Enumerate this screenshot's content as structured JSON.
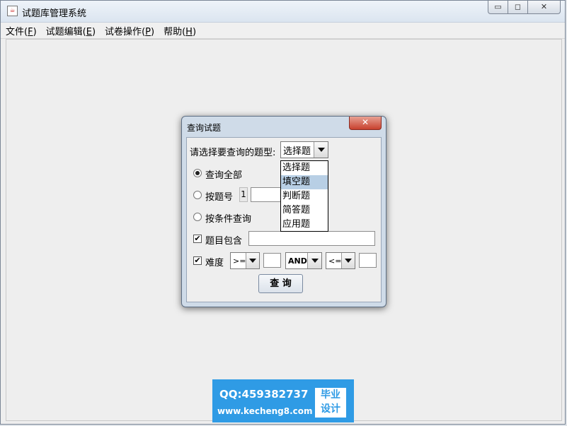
{
  "window": {
    "title": "试题库管理系统",
    "app_icon": "java-cup-icon",
    "buttons": {
      "minimize": "▭",
      "maximize": "◻",
      "close": "✕"
    }
  },
  "menu": {
    "items": [
      {
        "label": "文件",
        "mnemonic": "F"
      },
      {
        "label": "试题编辑",
        "mnemonic": "E"
      },
      {
        "label": "试卷操作",
        "mnemonic": "P"
      },
      {
        "label": "帮助",
        "mnemonic": "H"
      }
    ]
  },
  "dialog": {
    "title": "查询试题",
    "close_glyph": "✕",
    "type_prompt": "请选择要查询的题型:",
    "type_selected": "选择题",
    "type_options": [
      "选择题",
      "填空题",
      "判断题",
      "简答题",
      "应用题"
    ],
    "type_highlighted_index": 1,
    "radio_all": "查询全部",
    "radio_by_id": "按题号",
    "id_value": "1",
    "radio_by_condition": "按条件查询",
    "selected_radio": "all",
    "contains_label": "题目包含",
    "contains_checked": true,
    "difficulty_label": "难度",
    "difficulty_checked": true,
    "op1": ">=",
    "logic": "AND",
    "op2": "<=",
    "query_button": "查 询"
  },
  "banner": {
    "qq": "QQ:459382737",
    "site": "www.kecheng8.com",
    "badge_line1": "毕业",
    "badge_line2": "设计",
    "color": "#2f9be5"
  }
}
